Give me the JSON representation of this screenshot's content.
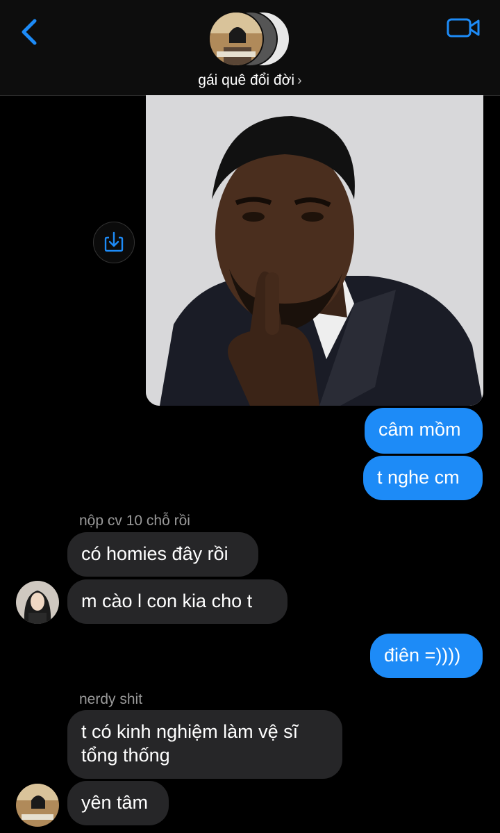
{
  "header": {
    "group_name": "gái quê đổi đời",
    "chevron": "›",
    "back_icon": "chevron-left-icon",
    "video_icon": "video-camera-icon",
    "accent": "#1d8bf7"
  },
  "conversation": {
    "photo_description_icon": "photo",
    "save_icon": "save-download-icon",
    "outgoing_1": "câm mồm",
    "outgoing_2": "t nghe cm",
    "sender_1": "nộp cv 10 chỗ rồi",
    "incoming_1": "có homies đây rồi",
    "incoming_2": "m cào l con kia cho t",
    "outgoing_3": "điên =))))",
    "sender_2": "nerdy shit",
    "incoming_3_line1": "t có kinh nghiệm làm vệ sĩ",
    "incoming_3_line2": "tổng thống",
    "incoming_4": "yên tâm"
  },
  "colors": {
    "outgoing_bubble": "#1d8bf7",
    "incoming_bubble": "#262628",
    "background": "#000000"
  }
}
